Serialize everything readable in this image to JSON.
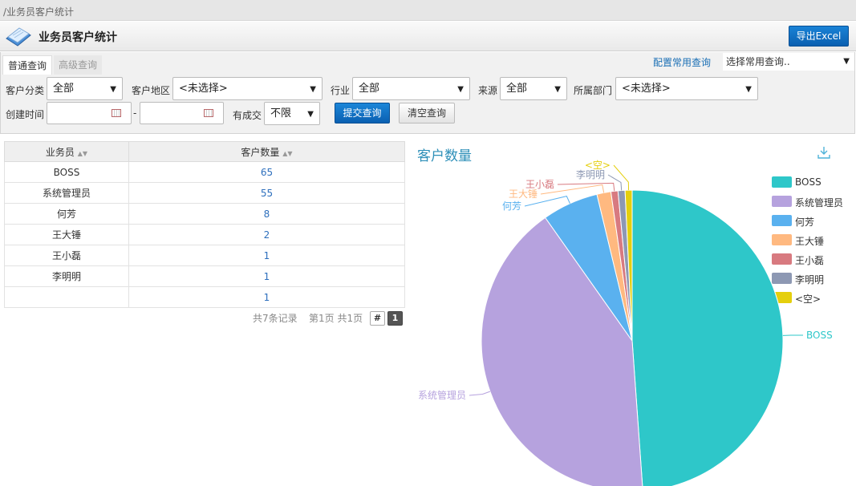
{
  "breadcrumb": "/业务员客户统计",
  "page_title": "业务员客户统计",
  "export_label": "导出Excel",
  "tabs": [
    {
      "label": "普通查询"
    },
    {
      "label": "高级查询"
    }
  ],
  "config_link": "配置常用查询",
  "common_query_select": "选择常用查询..",
  "filters": {
    "customer_type_label": "客户分类",
    "customer_type_value": "全部",
    "region_label": "客户地区",
    "region_value": "<未选择>",
    "industry_label": "行业",
    "industry_value": "全部",
    "source_label": "来源",
    "source_value": "全部",
    "dept_label": "所属部门",
    "dept_value": "<未选择>",
    "created_label": "创建时间",
    "date_dash": "-",
    "deal_label": "有成交",
    "deal_value": "不限",
    "submit_label": "提交查询",
    "clear_label": "清空查询"
  },
  "table": {
    "headers": [
      "业务员",
      "客户数量"
    ],
    "rows": [
      {
        "name": "BOSS",
        "count": "65"
      },
      {
        "name": "系统管理员",
        "count": "55"
      },
      {
        "name": "何芳",
        "count": "8"
      },
      {
        "name": "王大锤",
        "count": "2"
      },
      {
        "name": "王小磊",
        "count": "1"
      },
      {
        "name": "李明明",
        "count": "1"
      },
      {
        "name": "",
        "count": "1"
      }
    ]
  },
  "pager": {
    "total": "共7条记录",
    "pages": "第1页 共1页",
    "hash": "#",
    "current": "1"
  },
  "chart_data": {
    "type": "pie",
    "title": "客户数量",
    "legend_position": "right",
    "categories": [
      "BOSS",
      "系统管理员",
      "何芳",
      "王大锤",
      "王小磊",
      "李明明",
      "<空>"
    ],
    "values": [
      65,
      55,
      8,
      2,
      1,
      1,
      1
    ],
    "colors": [
      "#2ec7c9",
      "#b6a2de",
      "#5ab1ef",
      "#ffb980",
      "#d87a80",
      "#8d98b3",
      "#e5cf0d"
    ]
  }
}
